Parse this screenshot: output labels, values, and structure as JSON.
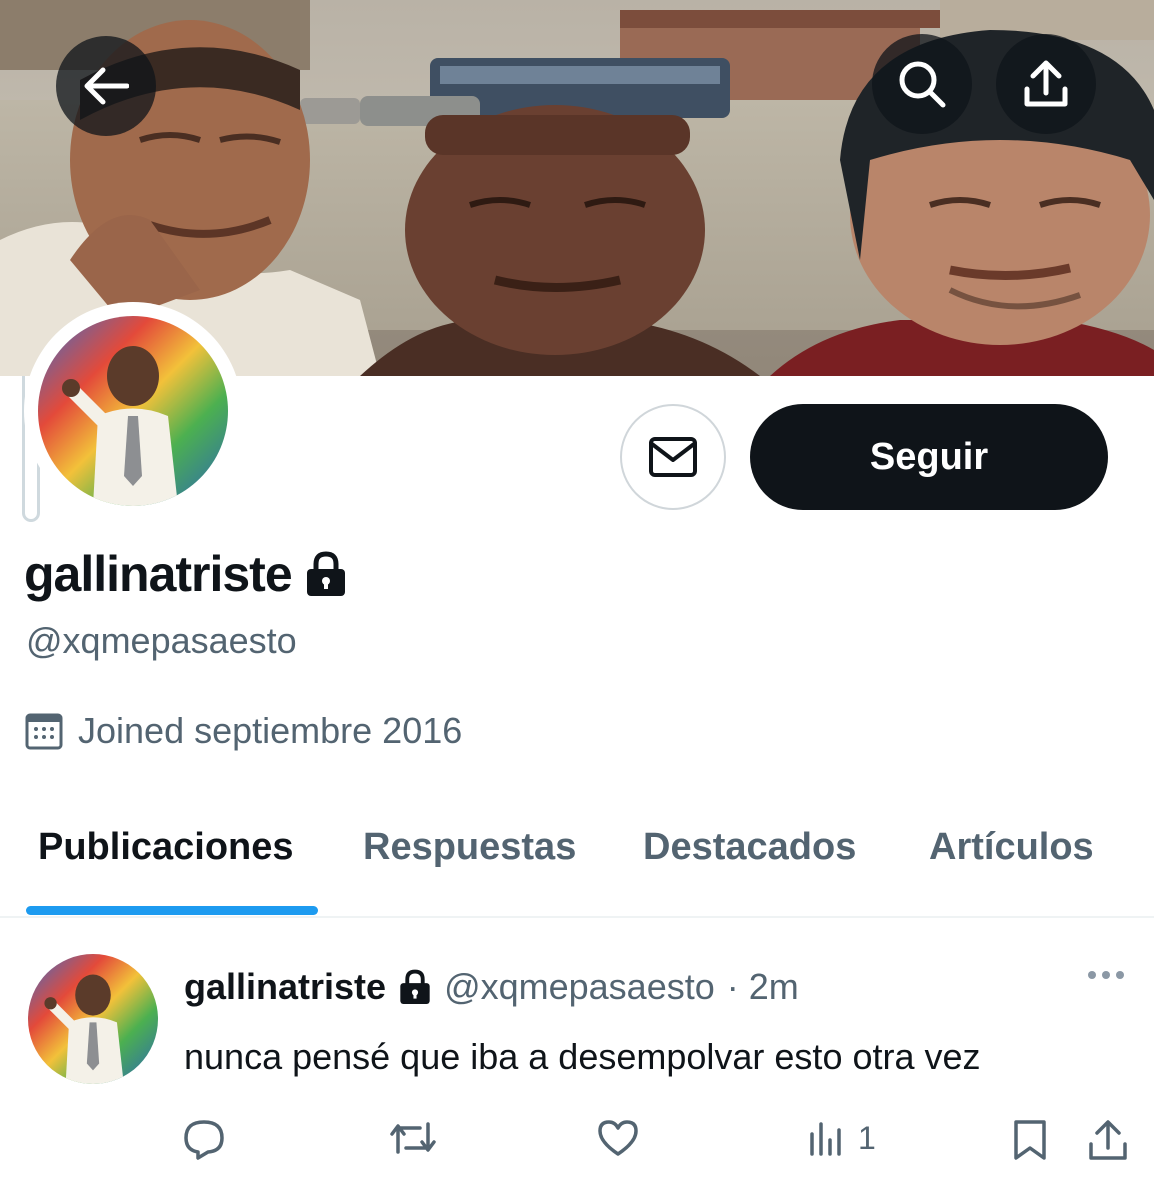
{
  "profile": {
    "display_name": "gallinatriste",
    "handle": "@xqmepasaesto",
    "joined": "Joined septiembre 2016",
    "follow_label": "Seguir"
  },
  "tabs": [
    {
      "label": "Publicaciones",
      "active": true
    },
    {
      "label": "Respuestas",
      "active": false
    },
    {
      "label": "Destacados",
      "active": false
    },
    {
      "label": "Artículos",
      "active": false
    }
  ],
  "post": {
    "author": "gallinatriste",
    "handle": "@xqmepasaesto",
    "time": "· 2m",
    "text": "nunca pensé que iba a desempolvar esto otra vez",
    "views": "1"
  },
  "icons": {
    "back": "arrow-left-icon",
    "search": "search-icon",
    "share": "share-icon",
    "message": "envelope-icon",
    "lock": "lock-icon",
    "calendar": "calendar-icon",
    "reply": "reply-icon",
    "repost": "repost-icon",
    "like": "heart-icon",
    "views": "views-icon",
    "bookmark": "bookmark-icon"
  },
  "colors": {
    "accent": "#1d9bf0",
    "text": "#0f1419",
    "muted": "#536471"
  }
}
